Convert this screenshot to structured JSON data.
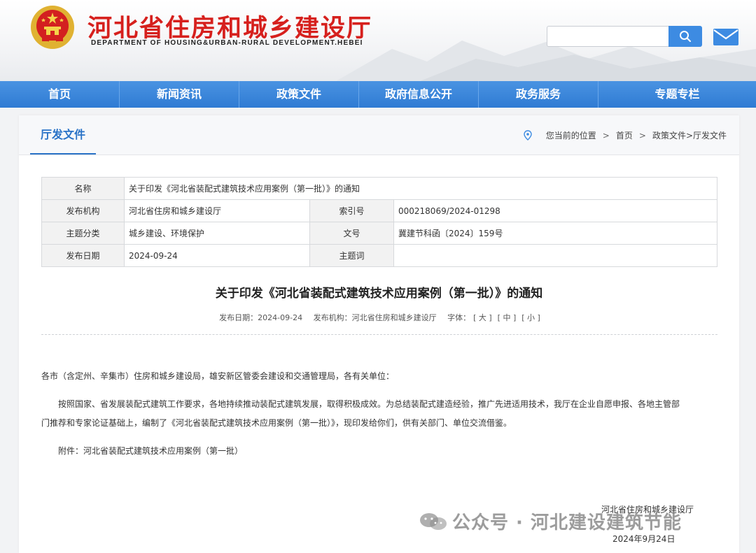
{
  "header": {
    "title": "河北省住房和城乡建设厅",
    "subtitle": "DEPARTMENT OF HOUSING&URBAN-RURAL DEVELOPMENT.HEBEI",
    "search_placeholder": "",
    "brand_color": "#d6201d",
    "accent_color": "#3d8be2"
  },
  "nav": {
    "items": [
      "首页",
      "新闻资讯",
      "政策文件",
      "政府信息公开",
      "政务服务",
      "专题专栏"
    ]
  },
  "panel": {
    "category": "厅发文件",
    "breadcrumb": {
      "location_label": "您当前的位置",
      "items": [
        "首页",
        "政策文件>厅发文件"
      ]
    }
  },
  "info_table": {
    "name_label": "名称",
    "name_value": "关于印发《河北省装配式建筑技术应用案例（第一批）》的通知",
    "issuer_label": "发布机构",
    "issuer_value": "河北省住房和城乡建设厅",
    "index_label": "索引号",
    "index_value": "000218069/2024-01298",
    "topic_label": "主题分类",
    "topic_value": "城乡建设、环境保护",
    "docno_label": "文号",
    "docno_value": "冀建节科函〔2024〕159号",
    "date_label": "发布日期",
    "date_value": "2024-09-24",
    "keyword_label": "主题词",
    "keyword_value": ""
  },
  "article": {
    "title": "关于印发《河北省装配式建筑技术应用案例（第一批）》的通知",
    "meta": {
      "date": "发布日期：2024-09-24",
      "issuer": "发布机构：河北省住房和城乡建设厅",
      "font_label": "字体：",
      "font_large": "[ 大 ]",
      "font_medium": "[ 中 ]",
      "font_small": "[ 小 ]"
    },
    "salutation": "各市（含定州、辛集市）住房和城乡建设局，雄安新区管委会建设和交通管理局，各有关单位：",
    "body_line1": "按照国家、省发展装配式建筑工作要求，各地持续推动装配式建筑发展，取得积极成效。为总结装配式建造经验，推广先进适用技术，我厅在企业自愿申报、各地主管部",
    "body_line2": "门推荐和专家论证基础上，编制了《河北省装配式建筑技术应用案例（第一批）》，现印发给你们，供有关部门、单位交流借鉴。",
    "attachment": "附件：河北省装配式建筑技术应用案例（第一批）",
    "sign_org": "河北省住房和城乡建设厅",
    "sign_date": "2024年9月24日"
  },
  "watermark": {
    "text": "公众号 · 河北建设建筑节能"
  }
}
